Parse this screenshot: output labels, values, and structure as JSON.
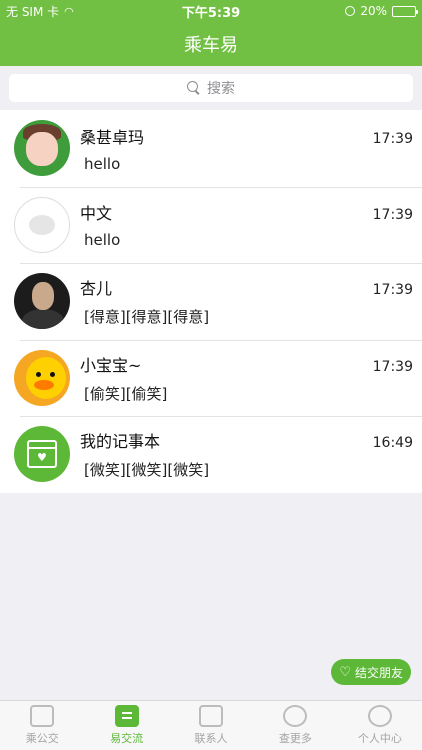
{
  "status_bar": {
    "carrier": "无 SIM 卡",
    "time": "下午5:39",
    "battery": "20%",
    "battery_level": 0.2
  },
  "header": {
    "title": "乘车易"
  },
  "search": {
    "placeholder": "搜索"
  },
  "conversations": [
    {
      "name": "桑甚卓玛",
      "time": "17:39",
      "message": "hello",
      "avatar_icon": "girl-avatar"
    },
    {
      "name": "中文",
      "time": "17:39",
      "message": "hello",
      "avatar_icon": "chat-bubble-avatar"
    },
    {
      "name": "杏儿",
      "time": "17:39",
      "message": "[得意][得意][得意]",
      "avatar_icon": "man-avatar"
    },
    {
      "name": "小宝宝~",
      "time": "17:39",
      "message": "[偷笑][偷笑]",
      "avatar_icon": "duck-avatar"
    },
    {
      "name": "我的记事本",
      "time": "16:49",
      "message": "[微笑][微笑][微笑]",
      "avatar_icon": "calendar-heart-avatar"
    }
  ],
  "add_friend": {
    "label": "结交朋友"
  },
  "tabbar": [
    {
      "label": "乘公交",
      "icon": "bus-icon",
      "active": false
    },
    {
      "label": "易交流",
      "icon": "chat-icon",
      "active": true
    },
    {
      "label": "联系人",
      "icon": "contacts-icon",
      "active": false
    },
    {
      "label": "查更多",
      "icon": "more-icon",
      "active": false
    },
    {
      "label": "个人中心",
      "icon": "user-icon",
      "active": false
    }
  ],
  "colors": {
    "accent": "#72c043",
    "battery_low": "#ff3b30"
  }
}
